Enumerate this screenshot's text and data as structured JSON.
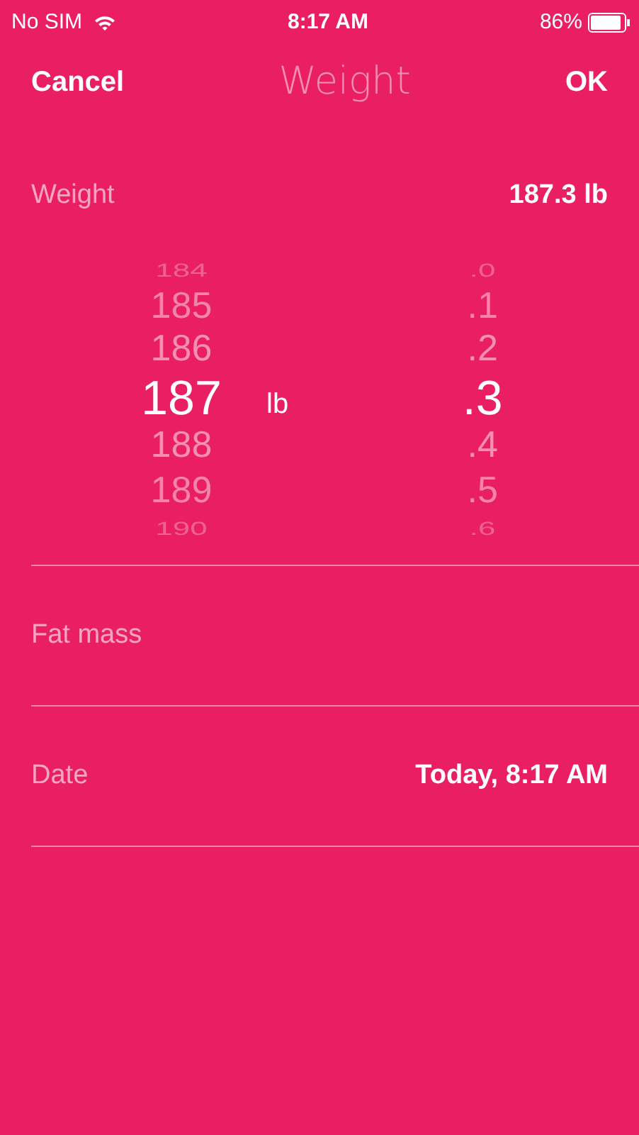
{
  "status_bar": {
    "carrier": "No SIM",
    "time": "8:17 AM",
    "battery": "86%"
  },
  "nav": {
    "cancel": "Cancel",
    "title": "Weight",
    "ok": "OK"
  },
  "weight_row": {
    "label": "Weight",
    "value": "187.3 lb"
  },
  "picker": {
    "unit": "lb",
    "wheels": [
      {
        "items": [
          {
            "label": "184",
            "selected": false
          },
          {
            "label": "185",
            "selected": false
          },
          {
            "label": "186",
            "selected": false
          },
          {
            "label": "187",
            "selected": true
          },
          {
            "label": "188",
            "selected": false
          },
          {
            "label": "189",
            "selected": false
          },
          {
            "label": "190",
            "selected": false
          }
        ]
      },
      {
        "items": [
          {
            "label": ".0",
            "selected": false
          },
          {
            "label": ".1",
            "selected": false
          },
          {
            "label": ".2",
            "selected": false
          },
          {
            "label": ".3",
            "selected": true
          },
          {
            "label": ".4",
            "selected": false
          },
          {
            "label": ".5",
            "selected": false
          },
          {
            "label": ".6",
            "selected": false
          }
        ]
      }
    ]
  },
  "fields": [
    {
      "label": "Fat mass"
    },
    {
      "label": "Date",
      "value": "Today, 8:17 AM"
    }
  ]
}
